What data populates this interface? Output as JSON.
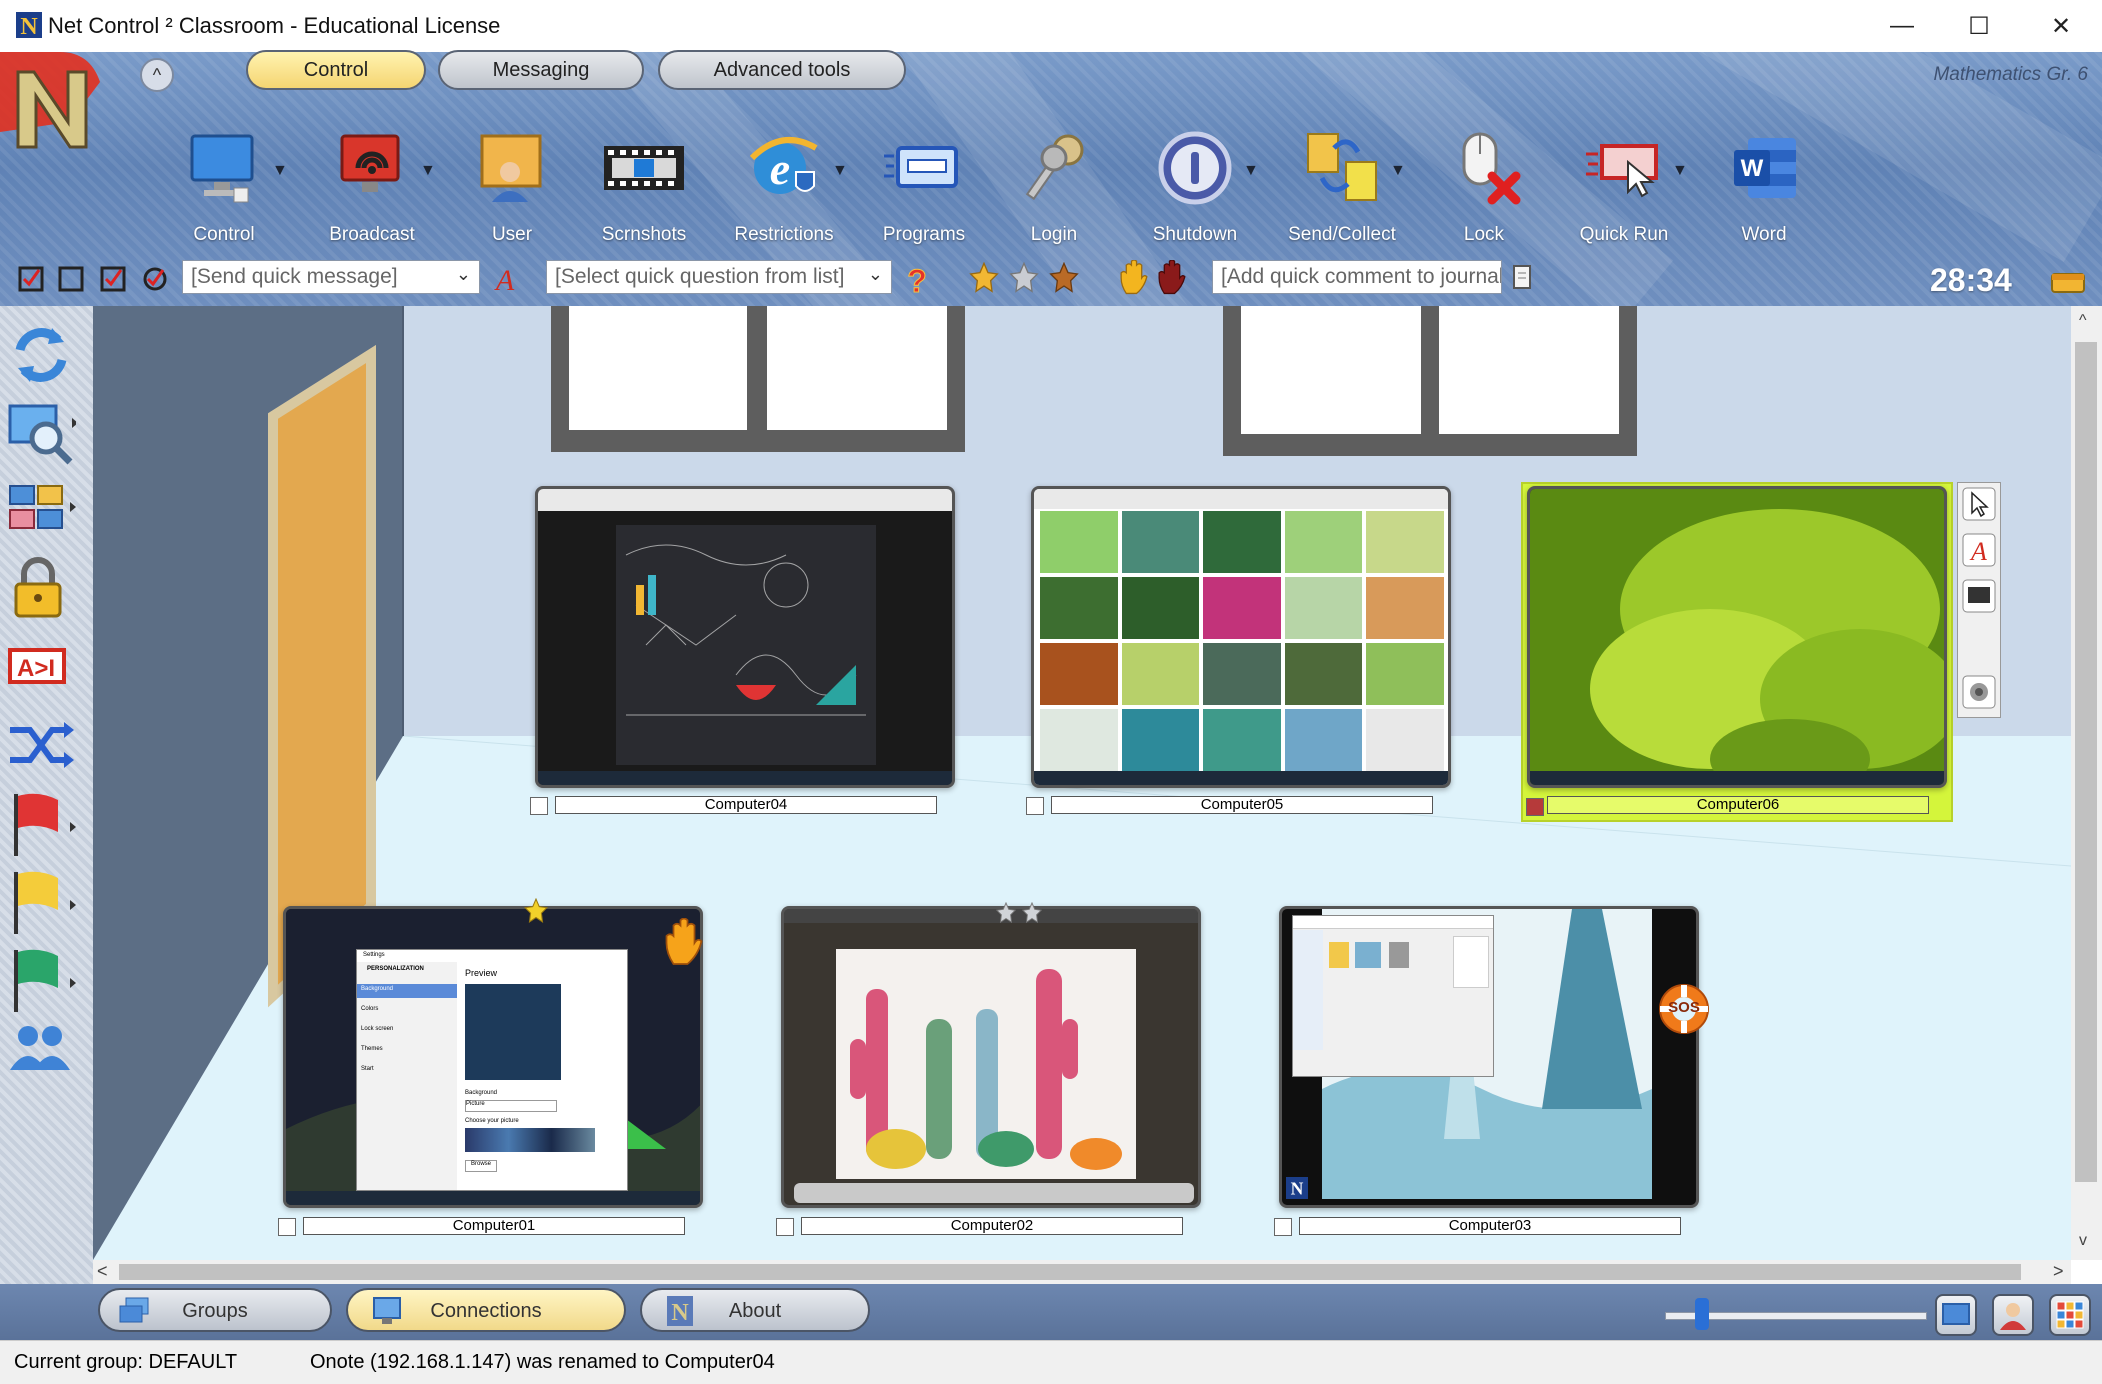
{
  "window": {
    "title": "Net Control ² Classroom - Educational License",
    "minimize": "—",
    "maximize": "☐",
    "close": "✕"
  },
  "ribbon": {
    "collapse_glyph": "^",
    "tabs": [
      {
        "label": "Control",
        "active": true
      },
      {
        "label": "Messaging",
        "active": false
      },
      {
        "label": "Advanced tools",
        "active": false
      }
    ],
    "class_name": "Mathematics Gr. 6",
    "tools": [
      {
        "label": "Control",
        "icon": "monitor-icon",
        "dropdown": true
      },
      {
        "label": "Broadcast",
        "icon": "broadcast-icon",
        "dropdown": true
      },
      {
        "label": "User",
        "icon": "user-icon",
        "dropdown": false
      },
      {
        "label": "Scrnshots",
        "icon": "film-strip-icon",
        "dropdown": false
      },
      {
        "label": "Restrictions",
        "icon": "internet-explorer-shield-icon",
        "dropdown": true
      },
      {
        "label": "Programs",
        "icon": "programs-window-icon",
        "dropdown": false
      },
      {
        "label": "Login",
        "icon": "keys-icon",
        "dropdown": false
      },
      {
        "label": "Shutdown",
        "icon": "power-icon",
        "dropdown": true
      },
      {
        "label": "Send/Collect",
        "icon": "documents-icon",
        "dropdown": true
      },
      {
        "label": "Lock",
        "icon": "mouse-lock-icon",
        "dropdown": false
      },
      {
        "label": "Quick Run",
        "icon": "quick-run-icon",
        "dropdown": true
      },
      {
        "label": "Word",
        "icon": "word-icon",
        "dropdown": false
      }
    ],
    "quick_message_placeholder": "[Send quick message]",
    "quick_question_placeholder": "[Select quick question from list]",
    "journal_placeholder": "[Add quick comment to journal]",
    "timer": "28:34"
  },
  "sidebar": {
    "items": [
      {
        "icon": "refresh-icon"
      },
      {
        "icon": "monitor-zoom-icon"
      },
      {
        "icon": "layout-grid-icon"
      },
      {
        "icon": "padlock-icon"
      },
      {
        "icon": "text-send-icon"
      },
      {
        "icon": "shuffle-icon"
      },
      {
        "icon": "red-flag-icon"
      },
      {
        "icon": "yellow-flag-icon"
      },
      {
        "icon": "green-flag-icon"
      },
      {
        "icon": "users-group-icon"
      }
    ]
  },
  "computers": [
    {
      "name": "Computer04",
      "selected": false
    },
    {
      "name": "Computer05",
      "selected": false
    },
    {
      "name": "Computer06",
      "selected": true
    },
    {
      "name": "Computer01",
      "selected": false
    },
    {
      "name": "Computer02",
      "selected": false
    },
    {
      "name": "Computer03",
      "selected": false
    }
  ],
  "computer01_screen": {
    "settings_title": "Settings",
    "section": "PERSONALIZATION",
    "menu": [
      "Background",
      "Colors",
      "Lock screen",
      "Themes",
      "Start"
    ],
    "preview": "Preview",
    "background_label": "Background",
    "background_value": "Picture",
    "choose_picture": "Choose your picture",
    "browse": "Browse"
  },
  "computer03_badge": "SOS",
  "bottom_tabs": [
    {
      "label": "Groups",
      "icon": "groups-icon",
      "active": false
    },
    {
      "label": "Connections",
      "icon": "connections-icon",
      "active": true
    },
    {
      "label": "About",
      "icon": "about-logo-icon",
      "active": false
    }
  ],
  "zoom_level": 0.12,
  "status": {
    "group": "Current group: DEFAULT",
    "message": "Onote (192.168.1.147) was renamed to Computer04"
  },
  "colors": {
    "ribbon_blue": "#6b8cc0",
    "active_tab": "#f5d572",
    "selected_computer": "#d4f53b",
    "sos": "#f07a1a"
  }
}
